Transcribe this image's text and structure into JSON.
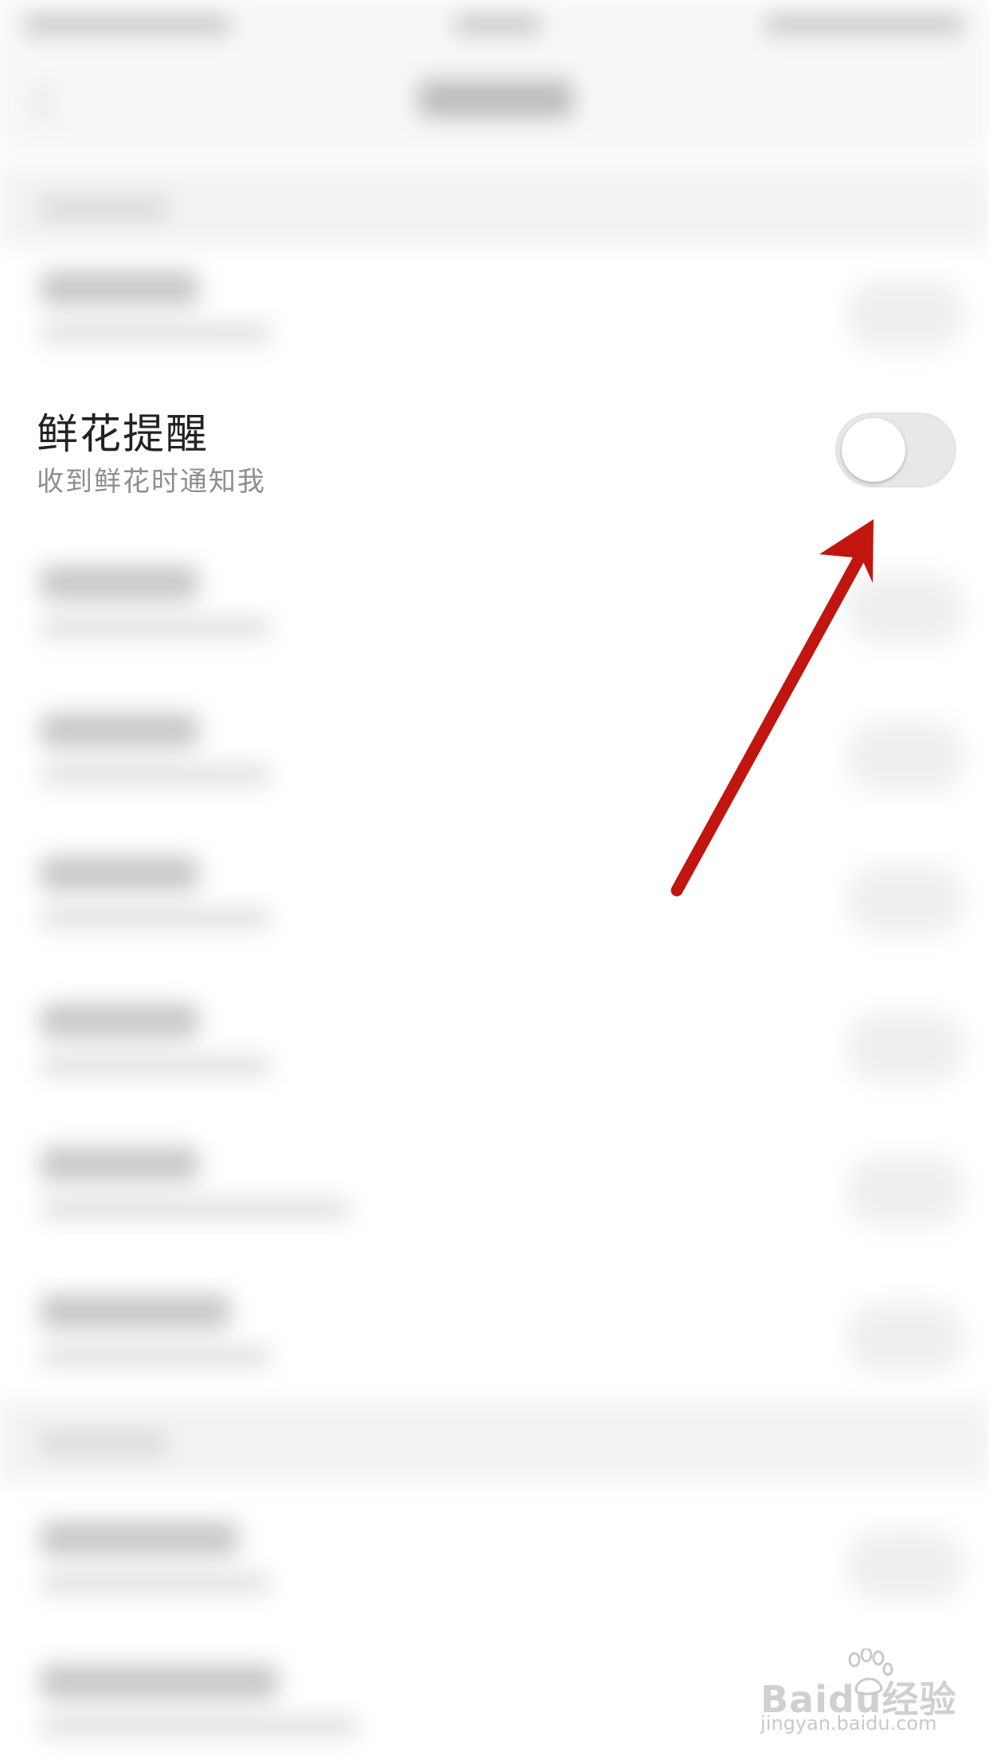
{
  "setting": {
    "title": "鲜花提醒",
    "subtitle": "收到鲜花时通知我",
    "toggle_on": false
  },
  "annotation": {
    "arrow_color": "#c0160f"
  },
  "watermark": {
    "brand": "Baidu经验",
    "url": "jingyan.baidu.com"
  }
}
